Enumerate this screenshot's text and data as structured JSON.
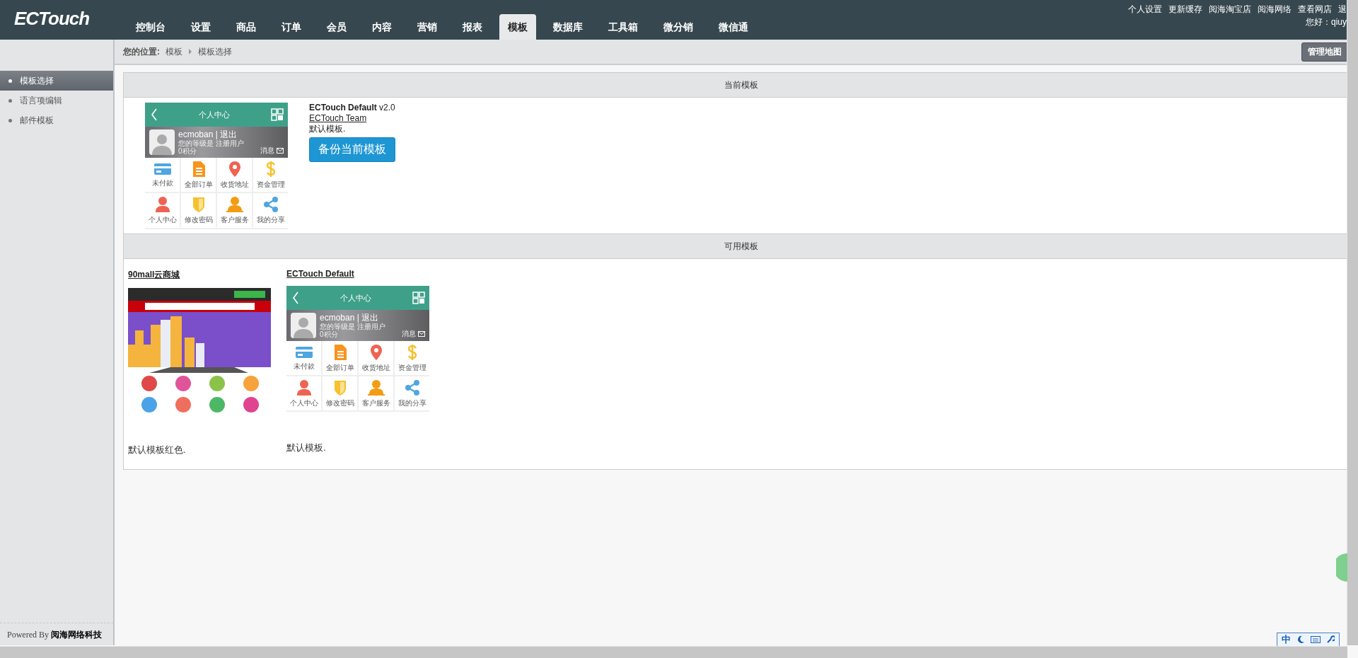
{
  "header": {
    "logo": "ECTouch",
    "nav": [
      {
        "label": "控制台",
        "selected": false
      },
      {
        "label": "设置",
        "selected": false
      },
      {
        "label": "商品",
        "selected": false
      },
      {
        "label": "订单",
        "selected": false
      },
      {
        "label": "会员",
        "selected": false
      },
      {
        "label": "内容",
        "selected": false
      },
      {
        "label": "营销",
        "selected": false
      },
      {
        "label": "报表",
        "selected": false
      },
      {
        "label": "模板",
        "selected": true
      },
      {
        "label": "数据库",
        "selected": false
      },
      {
        "label": "工具箱",
        "selected": false
      },
      {
        "label": "微分销",
        "selected": false
      },
      {
        "label": "微信通",
        "selected": false
      }
    ],
    "links": [
      "个人设置",
      "更新缓存",
      "阅海淘宝店",
      "阅海网络",
      "查看网店",
      "退"
    ],
    "greeting": "您好：qiuy"
  },
  "breadcrumb": {
    "label": "您的位置:",
    "items": [
      "模板",
      "模板选择"
    ],
    "button": "管理地图"
  },
  "sidebar": {
    "items": [
      {
        "label": "模板选择",
        "selected": true
      },
      {
        "label": "语言项编辑",
        "selected": false
      },
      {
        "label": "邮件模板",
        "selected": false
      }
    ],
    "footer_prefix": "Powered By",
    "footer_brand": "阅海网络科技"
  },
  "current": {
    "heading": "当前模板",
    "preview": {
      "title": "个人中心",
      "user": "ecmoban | 退出",
      "level": "您的等级是 注册用户",
      "points": "0积分",
      "message": "消息",
      "grid": [
        {
          "kind": "card",
          "label": "未付款"
        },
        {
          "kind": "doc",
          "label": "全部订单"
        },
        {
          "kind": "pin",
          "label": "收货地址"
        },
        {
          "kind": "dollar",
          "label": "资金管理"
        },
        {
          "kind": "person",
          "label": "个人中心"
        },
        {
          "kind": "shield",
          "label": "修改密码"
        },
        {
          "kind": "agent",
          "label": "客户服务"
        },
        {
          "kind": "share",
          "label": "我的分享"
        }
      ]
    },
    "name": "ECTouch Default",
    "version": "v2.0",
    "author": "ECTouch Team",
    "description": "默认模板.",
    "button": "备份当前模板"
  },
  "available": {
    "heading": "可用模板",
    "templates": [
      {
        "name": "90mall云商城",
        "description": "默认模板红色."
      },
      {
        "name": "ECTouch Default",
        "preview": {
          "kind": "mockup",
          "title": "个人中心",
          "user": "ecmoban | 退出",
          "level": "您的等级是 注册用户",
          "points": "0积分",
          "message": "消息",
          "grid": [
            {
              "kind": "card",
              "label": "未付款"
            },
            {
              "kind": "doc",
              "label": "全部订单"
            },
            {
              "kind": "pin",
              "label": "收货地址"
            },
            {
              "kind": "dollar",
              "label": "资金管理"
            },
            {
              "kind": "person",
              "label": "个人中心"
            },
            {
              "kind": "shield",
              "label": "修改密码"
            },
            {
              "kind": "agent",
              "label": "客户服务"
            },
            {
              "kind": "share",
              "label": "我的分享"
            }
          ]
        },
        "description": "默认模板."
      }
    ]
  },
  "ime_bar": {
    "mode": "中"
  }
}
